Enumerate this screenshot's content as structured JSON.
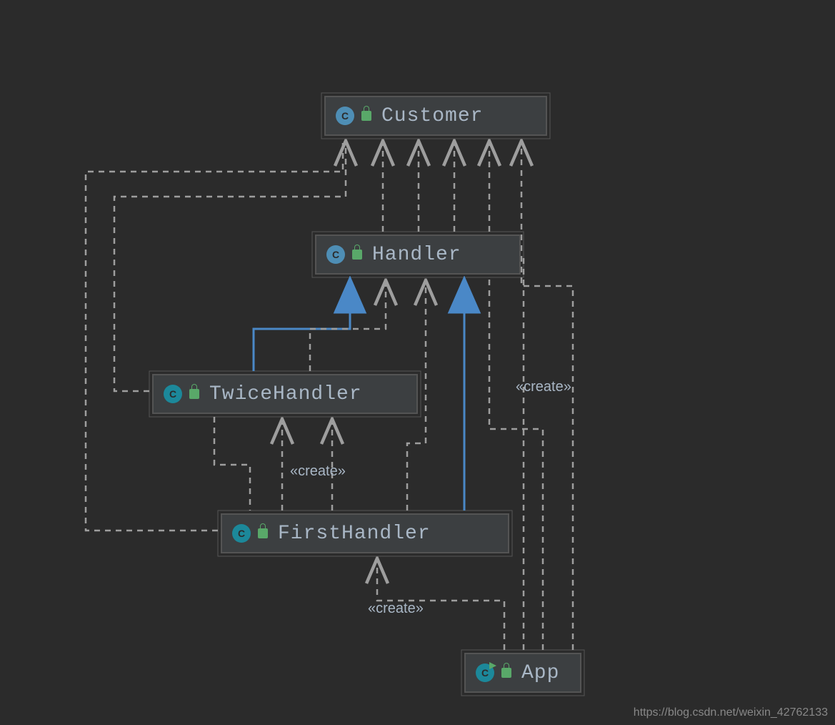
{
  "classes": {
    "customer": {
      "name": "Customer",
      "iconLetter": "C"
    },
    "handler": {
      "name": "Handler",
      "iconLetter": "C"
    },
    "twiceHandler": {
      "name": "TwiceHandler",
      "iconLetter": "C"
    },
    "firstHandler": {
      "name": "FirstHandler",
      "iconLetter": "C"
    },
    "app": {
      "name": "App",
      "iconLetter": "C"
    }
  },
  "labels": {
    "createTop": "«create»",
    "createMid": "«create»",
    "createBottom": "«create»"
  },
  "watermark": "https://blog.csdn.net/weixin_42762133",
  "colors": {
    "dashedLine": "#9e9e9e",
    "solidLine": "#4a88c7",
    "node": "#3c3f41"
  },
  "relationships": [
    {
      "from": "TwiceHandler",
      "to": "Handler",
      "type": "inheritance"
    },
    {
      "from": "FirstHandler",
      "to": "Handler",
      "type": "inheritance"
    },
    {
      "from": "TwiceHandler",
      "to": "Handler",
      "type": "dependency"
    },
    {
      "from": "FirstHandler",
      "to": "Handler",
      "type": "dependency"
    },
    {
      "from": "TwiceHandler",
      "to": "Customer",
      "type": "dependency"
    },
    {
      "from": "FirstHandler",
      "to": "Customer",
      "type": "dependency"
    },
    {
      "from": "Handler",
      "to": "Customer",
      "type": "dependency"
    },
    {
      "from": "FirstHandler",
      "to": "TwiceHandler",
      "type": "create"
    },
    {
      "from": "App",
      "to": "FirstHandler",
      "type": "create"
    },
    {
      "from": "App",
      "to": "Handler",
      "type": "dependency"
    },
    {
      "from": "App",
      "to": "Customer",
      "type": "create"
    }
  ]
}
